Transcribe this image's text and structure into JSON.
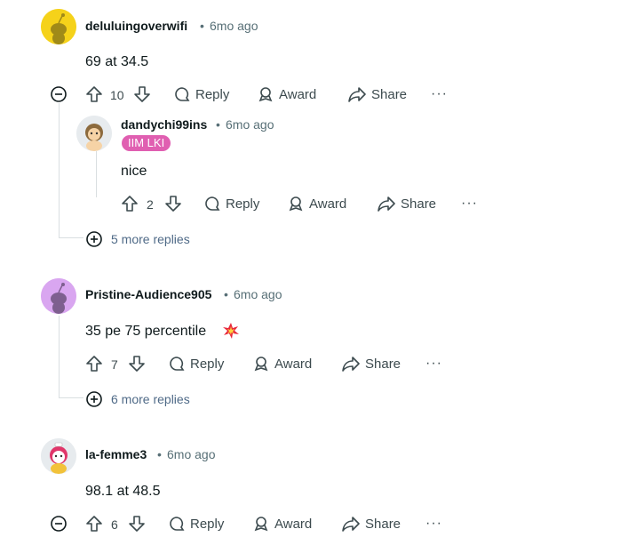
{
  "separator": "•",
  "actions": {
    "reply": "Reply",
    "award": "Award",
    "share": "Share",
    "more": "···"
  },
  "comments": [
    {
      "username": "deluluingoverwifi",
      "time": "6mo ago",
      "body": "69 at 34.5",
      "votes": "10"
    },
    {
      "username": "dandychi99ins",
      "time": "6mo ago",
      "flair": "IIM LKI",
      "body": "nice",
      "votes": "2"
    },
    {
      "username": "Pristine-Audience905",
      "time": "6mo ago",
      "body": "35 pe 75 percentile",
      "votes": "7"
    },
    {
      "username": "la-femme3",
      "time": "6mo ago",
      "body": "98.1 at 48.5",
      "votes": "6"
    }
  ],
  "more_replies": [
    "5 more replies",
    "6 more replies"
  ],
  "colors": {
    "flair_bg": "#e05fb1",
    "link": "#4f6a87",
    "meta": "#576f76",
    "thread": "#d9dfe1"
  },
  "icons": [
    "upvote-icon",
    "downvote-icon",
    "reply-bubble-icon",
    "award-icon",
    "share-arrow-icon",
    "collapse-minus-icon",
    "expand-plus-icon",
    "collision-emoji-icon"
  ]
}
